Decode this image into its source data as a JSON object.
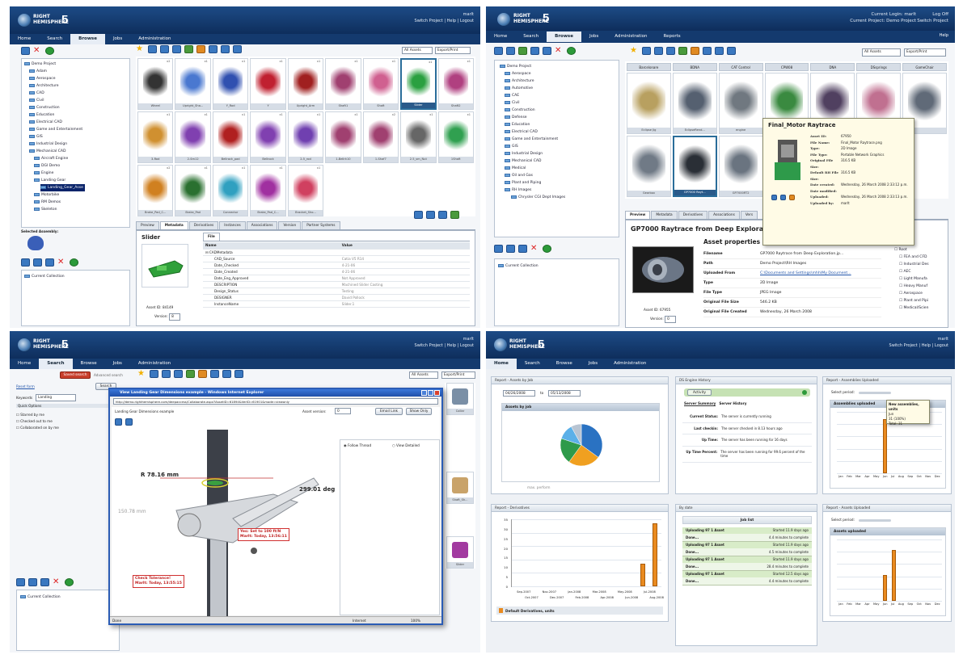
{
  "app": {
    "brand_top": "RIGHT",
    "brand_bottom": "HEMISPHERE",
    "version": "5"
  },
  "q1": {
    "header_right_user": "marlt",
    "header_right_links": "Switch Project  |  Help  |  Logout",
    "nav": [
      "Home",
      "Search",
      "Browse",
      "Jobs",
      "Administration"
    ],
    "nav_active": "Browse",
    "tree": [
      "Demo Project",
      "Adam",
      "Aerospace",
      "Architecture",
      "CAD",
      "Civil",
      "Construction",
      "Education",
      "Electrical CAD",
      "Game and Entertainment",
      "GIS",
      "Industrial Design",
      "Mechanical CAD",
      "Aircraft Engine",
      "DGI Demo",
      "Engine",
      "Landing Gear",
      "Landing_Gear_Asse",
      "Motorbike",
      "RM Demos",
      "Skeleton"
    ],
    "selected_assembly_label": "Selected Assembly:",
    "filter_all": "All Assets",
    "filter_export": "Export/Print",
    "row1_counts": [
      "x2",
      "x1",
      "x1",
      "x1",
      "x1",
      "x1",
      "x1",
      "x1",
      "x1"
    ],
    "row1_caps": [
      "Wheel",
      "Upright_Sha...",
      "Y_Rod",
      "Y",
      "Upright_Arm",
      "Shaft1",
      "Shaft",
      "Slider",
      "Shaft2"
    ],
    "row2_counts": [
      "x1",
      "x1",
      "x1",
      "x1",
      "x1",
      "x1",
      "x2",
      "x1",
      "x1"
    ],
    "row2_caps": [
      "3-Rod",
      "2-Sm12",
      "Bellrock_pad",
      "Bellrock",
      "2-5_rod",
      "1-Bellrk10",
      "1-Shaf7",
      "2.5_sm_Nut",
      "1Shaft"
    ],
    "row3_counts": [
      "x2",
      "x1",
      "x1",
      "x1",
      "x1"
    ],
    "row3_caps": [
      "Brake_Pad_C...",
      "Brake_Pad",
      "Connector",
      "Brake_Pad_C...",
      "Bracket_Sho..."
    ],
    "tabs": [
      "Preview",
      "Metadata",
      "Derivatives",
      "Instances",
      "Associations",
      "Version",
      "Partner Systems"
    ],
    "tab_active": "Metadata",
    "asset_title": "Slider",
    "file_tab": "File",
    "asset_id_label": "Asset ID:",
    "asset_id": "84149",
    "version_label": "Version:",
    "version": "8",
    "meta_headers": [
      "Name",
      "Value"
    ],
    "meta_group": "CADMetadata",
    "meta_rows": [
      [
        "CAD_Source",
        "Catia V5 R14"
      ],
      [
        "Date_Checked",
        "4-21-06"
      ],
      [
        "Date_Created",
        "4-21-06"
      ],
      [
        "Date_Eng_Approved",
        "Not Approved"
      ],
      [
        "DESCRIPTION",
        "Machined Slider Casting"
      ],
      [
        "Design_Status",
        "Testing"
      ],
      [
        "DESIGNER",
        "David Pollock"
      ],
      [
        "InstanceName",
        "Slider.1"
      ]
    ],
    "collection": "Current Collection"
  },
  "q2": {
    "header_login": "Current Login: marlt",
    "header_project": "Current Project: Demo Project",
    "header_logoff": "Log Off",
    "header_switch": "Switch Project",
    "nav": [
      "Home",
      "Search",
      "Browse",
      "Jobs",
      "Administration",
      "Reports"
    ],
    "nav_active": "Browse",
    "help": "Help",
    "filter_all": "All Assets",
    "filter_export": "Export/Print",
    "tree": [
      "Demo Project",
      "Aerospace",
      "Architecture",
      "Automotive",
      "CAE",
      "Civil",
      "Construction",
      "Defense",
      "Education",
      "Electrical CAD",
      "Game and Entertainment",
      "GIS",
      "Industrial Design",
      "Mechanical CAD",
      "Medical",
      "Oil and Gas",
      "Plant and Piping",
      "RH Images",
      "Chrysler CGI Dept Images"
    ],
    "grid_heads": [
      "Barcelonare",
      "BDNA",
      "CAT Control",
      "CPW08",
      "DNA",
      "DSsprings",
      "GameChair"
    ],
    "grid_caps_r1": [
      "Eclipse Jig",
      "EclipseRend...",
      "engine",
      "",
      "",
      "",
      ""
    ],
    "grid_caps_r2": [
      "Gearbox",
      "GP7000 Rayt...",
      "GP7000RT2",
      ""
    ],
    "tabs": [
      "Preview",
      "Metadata",
      "Derivatives",
      "Associations",
      "Vers"
    ],
    "tab_active": "Preview",
    "asset_title": "GP7000 Raytrace from Deep Exploration",
    "props_title": "Asset properties",
    "props": [
      [
        "Filename",
        "GP7000 Raytrace from Deep Exploration.jp..."
      ],
      [
        "Path",
        "Demo Project\\RH Images"
      ],
      [
        "Uploaded From",
        "C:\\Documents and Settings\\mhh\\My Document..."
      ],
      [
        "Type",
        "2D Image"
      ],
      [
        "File Type",
        "JPEG Image"
      ],
      [
        "Original File Size",
        "546.2 KB"
      ],
      [
        "Original File Created",
        "Wednesday, 26 March 2008"
      ]
    ],
    "asset_id_label": "Asset ID:",
    "asset_id": "67955",
    "version_label": "Version:",
    "version": "0",
    "tree2": [
      "Root",
      "FEA and CFD",
      "Industrial Des",
      "AEC",
      "Light Manufa",
      "Heavy Manuf",
      "Aerospace",
      "Plant and Pipi",
      "Medical/Scien"
    ],
    "tooltip_title": "Final_Motor Raytrace",
    "tooltip": [
      [
        "Asset ID:",
        "67950"
      ],
      [
        "File Name:",
        "Final_Motor Raytrace.png"
      ],
      [
        "Type:",
        "2D Image"
      ],
      [
        "File Type:",
        "Portable Network Graphics"
      ],
      [
        "Original File Size:",
        "316.5 KB"
      ],
      [
        "Default RH File Size:",
        "316.5 KB"
      ],
      [
        "Date created:",
        "Wednesday, 26 March 2008 2:33:12 p.m."
      ],
      [
        "Date modified:",
        ""
      ],
      [
        "Uploaded:",
        "Wednesday, 26 March 2008 2:33:13 p.m."
      ],
      [
        "Uploaded by:",
        "marlt"
      ]
    ],
    "collection": "Current Collection"
  },
  "q3": {
    "header_right_user": "marlt",
    "header_right_links": "Switch Project  |  Help  |  Logout",
    "nav": [
      "Home",
      "Search",
      "Browse",
      "Jobs",
      "Administration"
    ],
    "nav_active": "Search",
    "saved_search": "Saved search",
    "adv_search": "Advanced search",
    "reset_form": "Reset form",
    "search_btn": "Search",
    "keywords_label": "Keywords",
    "keywords_value": "Landing",
    "quick_options": "Quick Options",
    "checks": [
      "Starred by me",
      "Checked out to me",
      "Collaborated on by me"
    ],
    "filter_all": "All Assets",
    "filter_export": "Export/Print",
    "win_title": "View Landing Gear Dimensions example - Windows Internet Explorer",
    "win_url": "http://demo.righthemisphere.com/deepaccess/Collaborate.aspx?AssetID=61894&VerID=61901&mode=viewonly",
    "win_heading": "Landing Gear Dimensions example",
    "asset_version_label": "Asset version:",
    "asset_version": "0",
    "email_link": "Email Link",
    "show_only": "Show Only",
    "follow_thread": "Follow Thread",
    "view_detailed": "View Detailed",
    "dim1": "R 78.16 mm",
    "dim2": "299.01 deg",
    "dim3": "150.78 mm",
    "callout1_a": "Yes: Set to 100 ft/N",
    "callout1_b": "Marlt: Today, 13:56:11",
    "callout2_a": "Check Tolerance!",
    "callout2_b": "Marlt: Today, 13:55:15",
    "status_done": "Done",
    "status_zone": "Internet",
    "status_zoom": "100%",
    "side_caps": [
      "Collar",
      "Shaft_Sh...",
      "Slider"
    ],
    "collection": "Current Collection"
  },
  "q4": {
    "header_right_user": "marlt",
    "header_right_links": "Switch Project  |  Help  |  Logout",
    "nav": [
      "Home",
      "Search",
      "Browse",
      "Jobs",
      "Administration"
    ],
    "nav_active": "Home",
    "w1_title": "Report - Assets by Job",
    "w1_from": "04/26/2008",
    "w1_to_label": "to",
    "w1_to": "05/13/2008",
    "w1_chart": "Assets by job",
    "w1_footer": "max.  perform",
    "pie": [
      {
        "value": 35,
        "color": "#2a72c2"
      },
      {
        "value": 25,
        "color": "#f0a020"
      },
      {
        "value": 20,
        "color": "#2e9a4a"
      },
      {
        "value": 12,
        "color": "#5bb0e8"
      },
      {
        "value": 8,
        "color": "#b8c4d2"
      }
    ],
    "w2_title": "DS Engine History",
    "w2_status": "Activity",
    "w2_tabs": [
      "Server Summary",
      "Server History"
    ],
    "w2_rows": [
      [
        "Current Status:",
        "The server is currently running"
      ],
      [
        "Last checkin:",
        "The server checked in 8.13 hours ago"
      ],
      [
        "Up Time:",
        "The server has been running for 16 days"
      ],
      [
        "Up Time Percent:",
        "The server has been running for 99.6 percent of the time"
      ]
    ],
    "w3_title": "Report - Assemblies Uploaded",
    "w3_period": "Select period:",
    "w3_chart": "Assemblies uploaded",
    "w3_tip": [
      "New assemblies, units",
      "Jun",
      "31 (100%)",
      "Total: 31"
    ],
    "w3_months": [
      "Jan",
      "Feb",
      "Mar",
      "Apr",
      "May",
      "Jun",
      "Jul",
      "Aug",
      "Sep",
      "Oct",
      "Nov",
      "Dec"
    ],
    "w3_values": [
      0,
      0,
      0,
      0,
      0,
      31,
      0,
      0,
      0,
      0,
      0,
      0
    ],
    "w4_title": "Report - Derivatives",
    "w4_yticks": [
      "35",
      "30",
      "25",
      "20",
      "15",
      "10",
      "5",
      "0"
    ],
    "w4_xlabels_top": [
      "Sep-2007",
      "Nov-2007",
      "Jan-2008",
      "Mar-2008",
      "May-2008",
      "Jul-2008"
    ],
    "w4_xlabels_bot": [
      "Oct-2007",
      "Dec-2007",
      "Feb-2008",
      "Apr-2008",
      "Jun-2008",
      "Aug-2008"
    ],
    "w4_values": [
      0,
      0,
      0,
      0,
      0,
      0,
      0,
      0,
      0,
      0,
      12,
      33
    ],
    "w4_legend": "Default Derivatives, units",
    "w5_title": "By date",
    "w5_header": "Job list",
    "w5_items": [
      [
        "Uploading 97 1 Asset",
        "Started 11.9 days ago"
      ],
      [
        "Done...",
        "4.4 minutes to complete"
      ],
      [
        "Uploading 97 1 Asset",
        "Started 11.9 days ago"
      ],
      [
        "Done...",
        "4.5 minutes to complete"
      ],
      [
        "Uploading 97 1 Asset",
        "Started 11.9 days ago"
      ],
      [
        "Done...",
        "28.4 minutes to complete"
      ],
      [
        "Uploading 97 1 Asset",
        "Started 12.5 days ago"
      ],
      [
        "Done...",
        "4.4 minutes to complete"
      ]
    ],
    "w6_title": "Report - Assets Uploaded",
    "w6_period": "Select period:",
    "w6_chart": "Assets uploaded",
    "w6_months": [
      "Jan",
      "Feb",
      "Mar",
      "Apr",
      "May",
      "Jun",
      "Jul",
      "Aug",
      "Sep",
      "Oct",
      "Nov",
      "Dec"
    ],
    "w6_values": [
      0,
      0,
      0,
      0,
      0,
      5,
      10,
      0,
      0,
      0,
      0,
      0
    ]
  }
}
